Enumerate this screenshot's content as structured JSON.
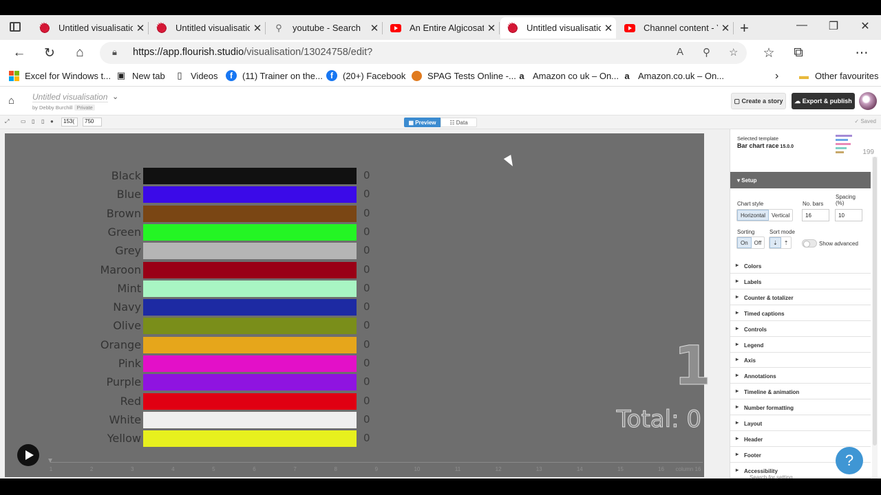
{
  "tabs": [
    {
      "title": "Untitled visualisatio",
      "favicon": "flourish-icon",
      "active": false
    },
    {
      "title": "Untitled visualisatio",
      "favicon": "flourish-icon",
      "active": false
    },
    {
      "title": "youtube - Search",
      "favicon": "search-icon",
      "active": false
    },
    {
      "title": "An Entire Algicosath",
      "favicon": "youtube-icon",
      "active": false
    },
    {
      "title": "Untitled visualisatio",
      "favicon": "flourish-icon",
      "active": true
    },
    {
      "title": "Channel content - Y",
      "favicon": "youtube-icon",
      "active": false
    }
  ],
  "address": {
    "host": "https://app.flourish.studio",
    "path": "/visualisation/13024758/edit?"
  },
  "bookmarks": [
    {
      "label": "Excel for Windows t...",
      "icon": "microsoft-icon"
    },
    {
      "label": "New tab",
      "icon": "newtab-icon"
    },
    {
      "label": "Videos",
      "icon": "page-icon"
    },
    {
      "label": "(11) Trainer on the...",
      "icon": "facebook-icon"
    },
    {
      "label": "(20+) Facebook",
      "icon": "facebook-icon"
    },
    {
      "label": "SPAG Tests Online -...",
      "icon": "spag-icon"
    },
    {
      "label": "Amazon co uk – On...",
      "icon": "amazon-icon"
    },
    {
      "label": "Amazon.co.uk – On...",
      "icon": "amazon-icon"
    }
  ],
  "other_favourites": "Other favourites",
  "header": {
    "title": "Untitled visualisation",
    "byline": "by Debby Burchill",
    "privacy": "Private",
    "create_story": "Create a story",
    "export_publish": "Export & publish"
  },
  "toolbar": {
    "width": "153(",
    "height": "750",
    "preview": "Preview",
    "data": "Data",
    "saved": "Saved"
  },
  "chart_data": {
    "type": "bar",
    "categories": [
      "Black",
      "Blue",
      "Brown",
      "Green",
      "Grey",
      "Maroon",
      "Mint",
      "Navy",
      "Olive",
      "Orange",
      "Pink",
      "Purple",
      "Red",
      "White",
      "Yellow"
    ],
    "values": [
      0,
      0,
      0,
      0,
      0,
      0,
      0,
      0,
      0,
      0,
      0,
      0,
      0,
      0,
      0
    ],
    "colors": [
      "#111111",
      "#3b0ae8",
      "#7a4614",
      "#24f524",
      "#b5b5b5",
      "#990016",
      "#a8f5c3",
      "#1d2aa3",
      "#7a8e1a",
      "#e6a61b",
      "#e310c8",
      "#8f14e0",
      "#e00012",
      "#efefef",
      "#e7f01e"
    ],
    "value_labels": [
      "0",
      "0",
      "0",
      "0",
      "0",
      "0",
      "0",
      "0",
      "0",
      "0",
      "0",
      "0",
      "0",
      "0",
      "0"
    ],
    "counter": "1",
    "total_label": "Total: 0",
    "timeline_ticks": [
      "1",
      "2",
      "3",
      "4",
      "5",
      "6",
      "7",
      "8",
      "9",
      "10",
      "11",
      "12",
      "13",
      "14",
      "15",
      "16",
      "column 16"
    ]
  },
  "panel": {
    "selected_template": "Selected template",
    "template_name": "Bar chart race",
    "template_version": "15.0.0",
    "thumb_number": "199",
    "setup": "Setup",
    "chart_style_label": "Chart style",
    "chart_style_options": [
      "Horizontal",
      "Vertical"
    ],
    "no_bars_label": "No. bars",
    "no_bars_value": "16",
    "spacing_label": "Spacing (%)",
    "spacing_value": "10",
    "sorting_label": "Sorting",
    "sorting_options": [
      "On",
      "Off"
    ],
    "sort_mode_label": "Sort mode",
    "show_advanced": "Show advanced",
    "sections": [
      "Colors",
      "Labels",
      "Counter & totalizer",
      "Timed captions",
      "Controls",
      "Legend",
      "Axis",
      "Annotations",
      "Timeline & animation",
      "Number formatting",
      "Layout",
      "Header",
      "Footer",
      "Accessibility"
    ],
    "search_placeholder": "Search for setting",
    "help": "?"
  }
}
